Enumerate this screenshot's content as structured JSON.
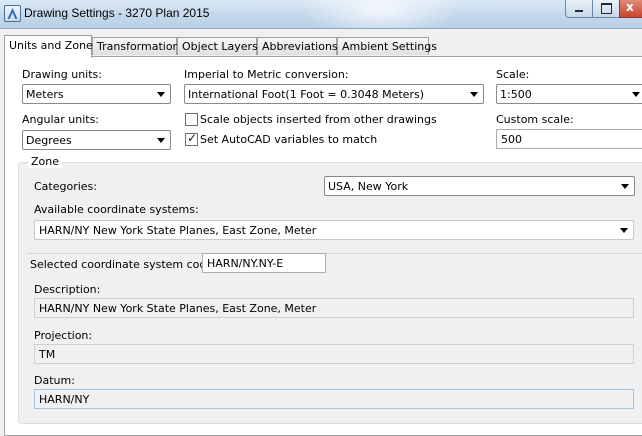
{
  "window": {
    "title": "Drawing Settings - 3270 Plan 2015",
    "close_glyph": "x"
  },
  "tabs": [
    {
      "label": "Units and Zone",
      "active": true
    },
    {
      "label": "Transformation",
      "active": false
    },
    {
      "label": "Object Layers",
      "active": false
    },
    {
      "label": "Abbreviations",
      "active": false
    },
    {
      "label": "Ambient Settings",
      "active": false
    }
  ],
  "units": {
    "drawing_units_label": "Drawing units:",
    "drawing_units_value": "Meters",
    "conversion_label": "Imperial to Metric conversion:",
    "conversion_value": "International Foot(1 Foot = 0.3048 Meters)",
    "scale_label": "Scale:",
    "scale_value": "1:500",
    "angular_units_label": "Angular units:",
    "angular_units_value": "Degrees",
    "scale_objects_label": "Scale objects inserted from other drawings",
    "scale_objects_checked": false,
    "set_autocad_label": "Set AutoCAD variables to match",
    "set_autocad_checked": true,
    "custom_scale_label": "Custom scale:",
    "custom_scale_value": "500"
  },
  "zone": {
    "legend": "Zone",
    "categories_label": "Categories:",
    "categories_value": "USA, New York",
    "available_label": "Available coordinate systems:",
    "available_value": "HARN/NY New York State Planes, East Zone, Meter",
    "selected_code_label": "Selected coordinate system code:",
    "selected_code_value": "HARN/NY.NY-E",
    "description_label": "Description:",
    "description_value": "HARN/NY New York State Planes, East Zone, Meter",
    "projection_label": "Projection:",
    "projection_value": "TM",
    "datum_label": "Datum:",
    "datum_value": "HARN/NY"
  }
}
